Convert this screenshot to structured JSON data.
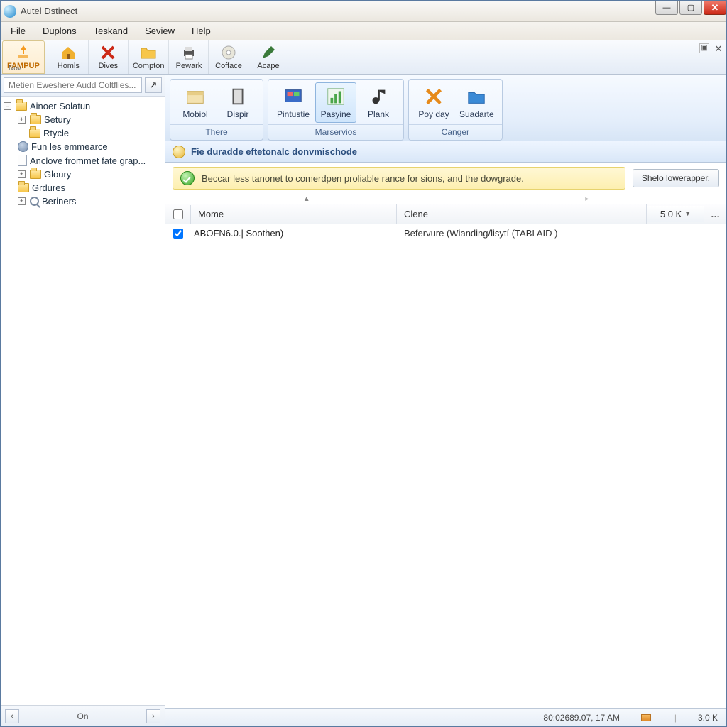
{
  "window": {
    "title": "Autel Dstinect"
  },
  "menu": {
    "items": [
      "File",
      "Duplons",
      "Teskand",
      "Seview",
      "Help"
    ]
  },
  "toolbar": {
    "fampup": {
      "label": "FAMPUP",
      "sublabel": "Nov"
    },
    "buttons": [
      {
        "label": "Homls",
        "icon": "home"
      },
      {
        "label": "Dives",
        "icon": "x-red"
      },
      {
        "label": "Compton",
        "icon": "folder"
      },
      {
        "label": "Pewark",
        "icon": "printer"
      },
      {
        "label": "Cofface",
        "icon": "disc"
      },
      {
        "label": "Acape",
        "icon": "pen"
      }
    ]
  },
  "sidebar": {
    "search_placeholder": "Metien Eweshere Audd Coltflies...",
    "root": "Ainoer Solatun",
    "items": [
      {
        "label": "Setury",
        "icon": "folder",
        "expand": "+"
      },
      {
        "label": "Rtycle",
        "icon": "folder"
      },
      {
        "label": "Fun les emmearce",
        "icon": "gear"
      },
      {
        "label": "Anclove frommet fate grap...",
        "icon": "doc"
      },
      {
        "label": "Gloury",
        "icon": "folder",
        "expand": "+"
      },
      {
        "label": "Grdures",
        "icon": "folder"
      },
      {
        "label": "Beriners",
        "icon": "search",
        "expand": "+"
      }
    ],
    "bottom": {
      "left": "‹",
      "mid": "On",
      "right": "›"
    }
  },
  "ribbon": {
    "groups": [
      {
        "title": "There",
        "buttons": [
          {
            "label": "Mobiol",
            "icon": "box"
          },
          {
            "label": "Dispir",
            "icon": "book"
          }
        ]
      },
      {
        "title": "Marservios",
        "buttons": [
          {
            "label": "Pintustie",
            "icon": "screen"
          },
          {
            "label": "Pasyine",
            "icon": "chart",
            "active": true
          },
          {
            "label": "Plank",
            "icon": "note"
          }
        ]
      },
      {
        "title": "Canger",
        "buttons": [
          {
            "label": "Poy day",
            "icon": "x-orange"
          },
          {
            "label": "Suadarte",
            "icon": "folder-blue"
          }
        ]
      }
    ]
  },
  "header": {
    "title": "Fie duradde eftetonalc donvmischode"
  },
  "info": {
    "text": "Beccar less tanonet to comerdpen proliable rance for sions, and the dowgrade.",
    "button": "Shelo lowerapper."
  },
  "table": {
    "columns": {
      "name": "Mome",
      "clene": "Clene"
    },
    "count_label": "5 0 K",
    "rows": [
      {
        "checked": true,
        "name": "ABOFN6.0.| Soothen)",
        "clene": "Befervure (Wianding/lisytí (TABI AID )"
      }
    ]
  },
  "status": {
    "time": "80:02689.07,  17 AM",
    "rate": "3.0 K"
  }
}
